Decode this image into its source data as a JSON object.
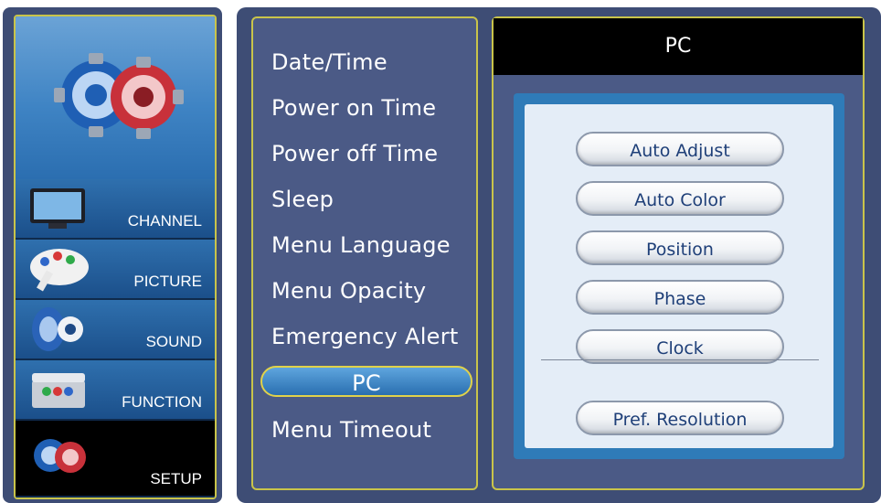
{
  "sidebar": {
    "categories": [
      {
        "label": "CHANNEL",
        "icon": "tv-icon"
      },
      {
        "label": "PICTURE",
        "icon": "palette-icon"
      },
      {
        "label": "SOUND",
        "icon": "speaker-icon"
      },
      {
        "label": "FUNCTION",
        "icon": "toolbox-icon"
      },
      {
        "label": "SETUP",
        "icon": "gears-icon",
        "active": true
      }
    ]
  },
  "menu": {
    "items": [
      {
        "label": "Date/Time"
      },
      {
        "label": "Power on Time"
      },
      {
        "label": "Power off Time"
      },
      {
        "label": "Sleep"
      },
      {
        "label": "Menu Language"
      },
      {
        "label": "Menu Opacity"
      },
      {
        "label": "Emergency Alert"
      },
      {
        "label": "PC",
        "selected": true
      },
      {
        "label": "Menu Timeout"
      }
    ]
  },
  "detail": {
    "title": "PC",
    "buttons": [
      {
        "label": "Auto Adjust"
      },
      {
        "label": "Auto Color"
      },
      {
        "label": "Position"
      },
      {
        "label": "Phase"
      },
      {
        "label": "Clock"
      }
    ],
    "secondary_button": {
      "label": "Pref. Resolution"
    }
  },
  "colors": {
    "panel_bg": "#3e4d75",
    "frame_gold": "#c9c44a",
    "accent_blue": "#2f7bb8",
    "selected_blue": "#2a6fb0"
  }
}
